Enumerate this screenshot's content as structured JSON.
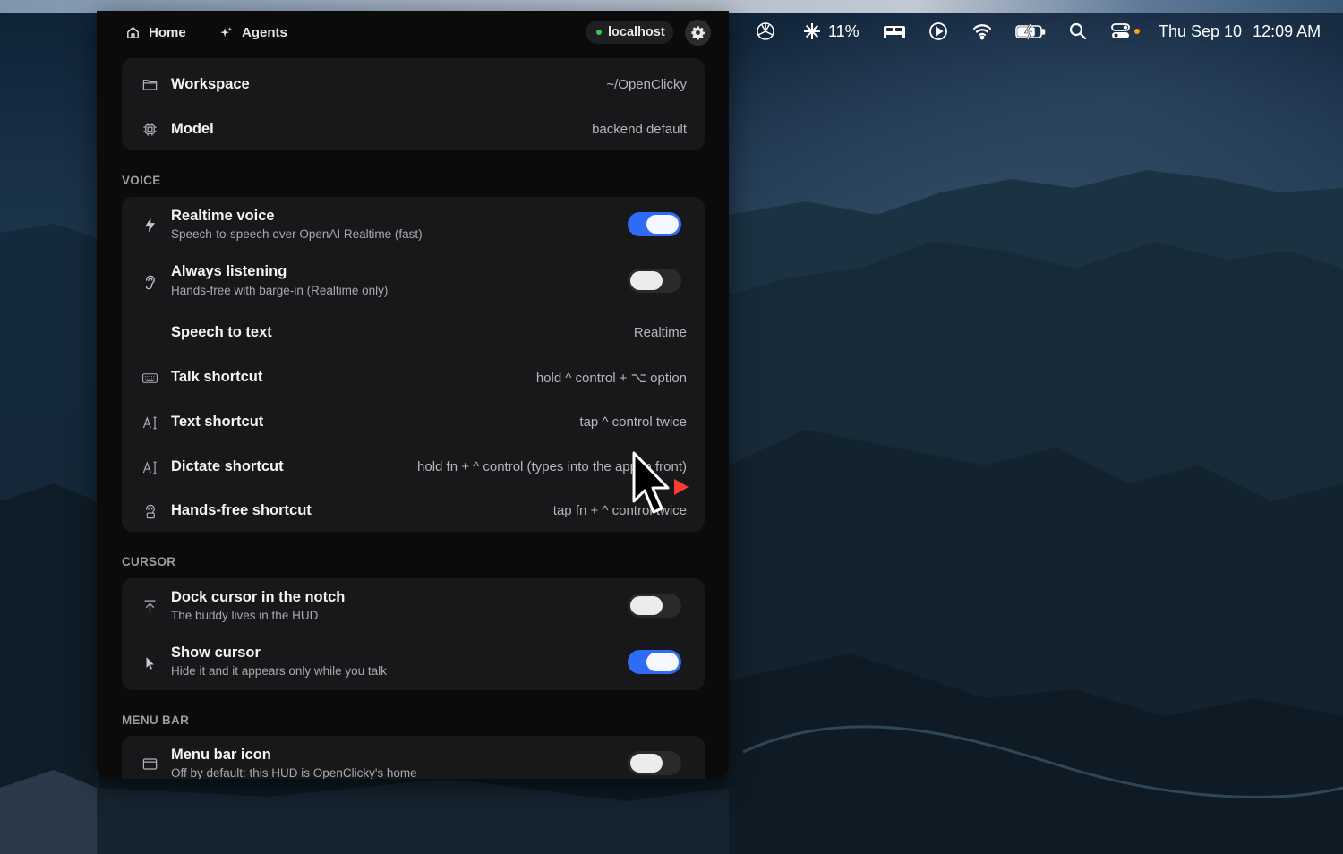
{
  "topbar": {
    "home_label": "Home",
    "agents_label": "Agents",
    "host_label": "localhost",
    "host_status_color": "#34c759"
  },
  "info_card": {
    "workspace_label": "Workspace",
    "workspace_value": "~/OpenClicky",
    "model_label": "Model",
    "model_value": "backend default"
  },
  "voice": {
    "section_title": "VOICE",
    "realtime_voice": {
      "title": "Realtime voice",
      "subtitle": "Speech-to-speech over OpenAI Realtime (fast)",
      "enabled": true
    },
    "always_listening": {
      "title": "Always listening",
      "subtitle": "Hands-free with barge-in (Realtime only)",
      "enabled": false
    },
    "speech_to_text": {
      "title": "Speech to text",
      "value": "Realtime"
    },
    "talk_shortcut": {
      "title": "Talk shortcut",
      "value": "hold ^ control + ⌥ option"
    },
    "text_shortcut": {
      "title": "Text shortcut",
      "value": "tap ^ control twice"
    },
    "dictate_shortcut": {
      "title": "Dictate shortcut",
      "value": "hold fn + ^ control (types into the app in front)"
    },
    "handsfree_shortcut": {
      "title": "Hands-free shortcut",
      "value": "tap fn + ^ control twice"
    }
  },
  "cursor": {
    "section_title": "CURSOR",
    "dock_cursor": {
      "title": "Dock cursor in the notch",
      "subtitle": "The buddy lives in the HUD",
      "enabled": false
    },
    "show_cursor": {
      "title": "Show cursor",
      "subtitle": "Hide it and it appears only while you talk",
      "enabled": true
    }
  },
  "menu_bar": {
    "section_title": "MENU BAR",
    "menu_bar_icon": {
      "title": "Menu bar icon",
      "subtitle": "Off by default: this HUD is OpenClicky's home",
      "enabled": false
    }
  },
  "system_menubar": {
    "brightness": "11%",
    "date": "Thu Sep 10",
    "time": "12:09 AM",
    "icons": [
      "openai-icon",
      "sun-icon",
      "bed-icon",
      "play-icon",
      "wifi-icon",
      "battery-charging-icon",
      "search-icon",
      "control-center-icon"
    ],
    "accent_dot_color": "#ff9f0a"
  },
  "colors": {
    "toggle_on": "#2f6cf6",
    "panel_bg": "#0b0b0c",
    "card_bg": "#18181a"
  }
}
